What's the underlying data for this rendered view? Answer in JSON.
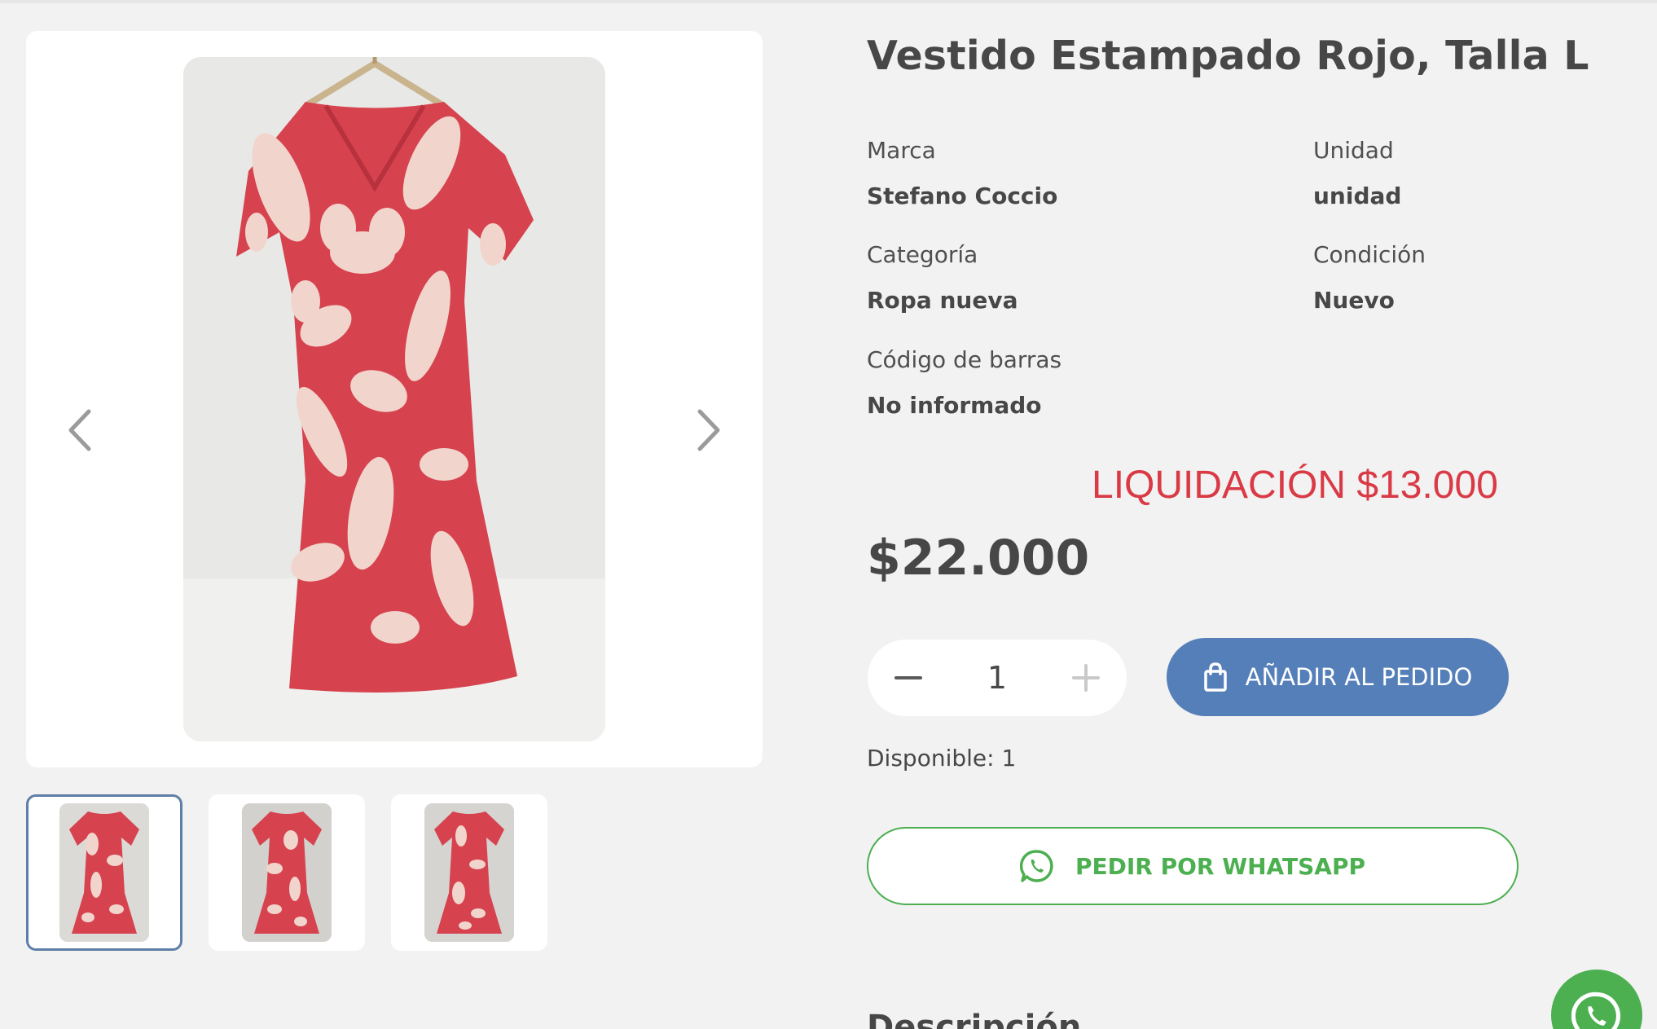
{
  "product": {
    "title": "Vestido Estampado Rojo, Talla L",
    "attributes": [
      {
        "label": "Marca",
        "value": "Stefano Coccio"
      },
      {
        "label": "Unidad",
        "value": "unidad"
      },
      {
        "label": "Categoría",
        "value": "Ropa nueva"
      },
      {
        "label": "Condición",
        "value": "Nuevo"
      },
      {
        "label": "Código de barras",
        "value": "No informado"
      }
    ],
    "promo": "LIQUIDACIÓN $13.000",
    "price": "$22.000",
    "quantity": "1",
    "available": "Disponible: 1"
  },
  "actions": {
    "add_to_order": "AÑADIR AL PEDIDO",
    "order_whatsapp": "PEDIR POR WHATSAPP"
  },
  "gallery": {
    "thumbnails": [
      {
        "active": true
      },
      {
        "active": false
      },
      {
        "active": false
      }
    ]
  },
  "description": {
    "heading": "Descripción"
  },
  "colors": {
    "accent_blue": "#557fb9",
    "whatsapp_green": "#4caf50",
    "promo_red": "#d93a45",
    "dress_red": "#d6434f",
    "dress_print": "#f1d5cc"
  },
  "icons": [
    "chevron-left-icon",
    "chevron-right-icon",
    "minus-icon",
    "plus-icon",
    "shopping-bag-icon",
    "whatsapp-icon"
  ]
}
